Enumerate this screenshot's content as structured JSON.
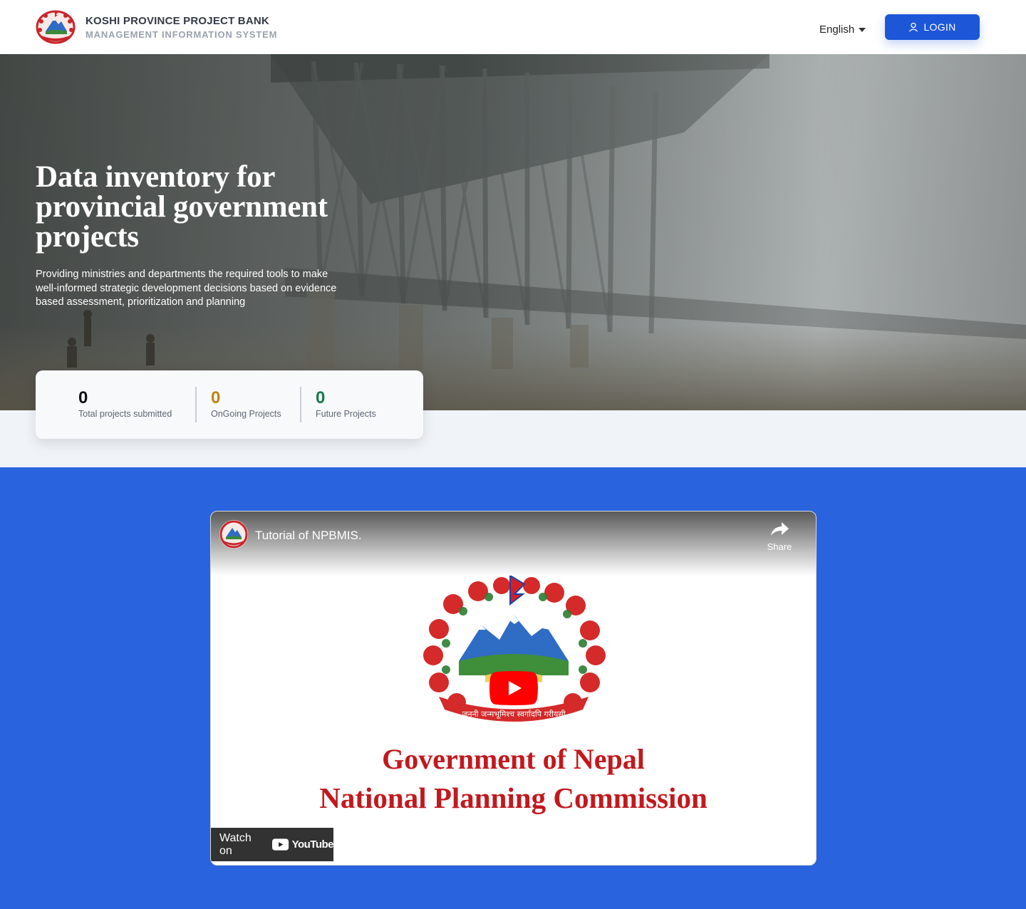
{
  "header": {
    "brand_title": "KOSHI PROVINCE PROJECT BANK",
    "brand_subtitle": "MANAGEMENT INFORMATION SYSTEM",
    "language": "English",
    "login_label": "LOGIN"
  },
  "hero": {
    "title": "Data inventory for provincial government projects",
    "description": "Providing ministries and departments the required tools to make well-informed strategic development decisions based on evidence based assessment, prioritization and planning"
  },
  "stats": [
    {
      "value": "0",
      "label": "Total projects submitted",
      "color": "#111111"
    },
    {
      "value": "0",
      "label": "OnGoing Projects",
      "color": "#c28313"
    },
    {
      "value": "0",
      "label": "Future Projects",
      "color": "#157a4f"
    }
  ],
  "video": {
    "title": "Tutorial of NPBMIS.",
    "share_label": "Share",
    "watch_on_label": "Watch on",
    "youtube_label": "YouTube",
    "thumbnail_motto": "जननी जन्मभूमिश्च स्वर्गादपि गरीयसी",
    "thumbnail_line1": "Government of Nepal",
    "thumbnail_line2": "National Planning Commission"
  },
  "colors": {
    "accent": "#1d57d8",
    "video_section_bg": "#2963de",
    "page_bg": "#f0f4f8"
  },
  "icons": {
    "emblem": "nepal-emblem-icon",
    "user": "user-icon",
    "caret": "caret-down-icon",
    "share": "share-arrow-icon",
    "play": "youtube-play-icon"
  }
}
